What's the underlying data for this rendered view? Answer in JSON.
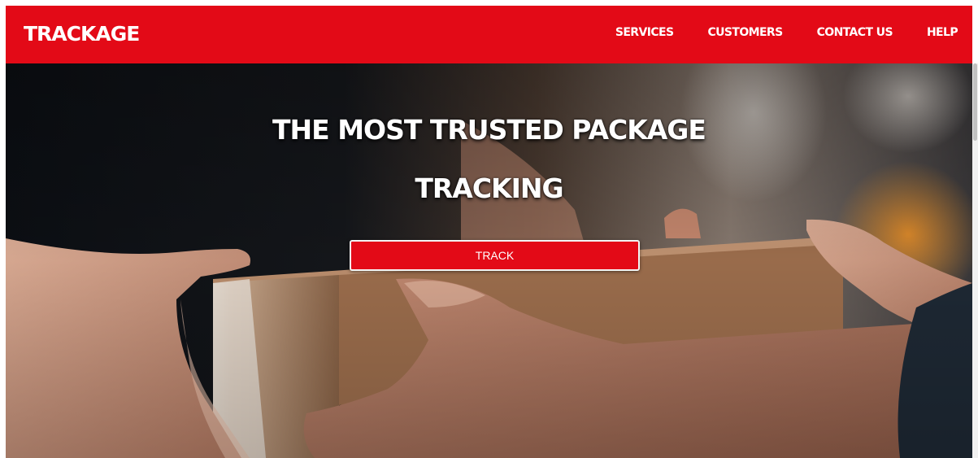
{
  "brand": {
    "name": "TRACKAGE"
  },
  "nav": {
    "items": [
      {
        "label": "SERVICES"
      },
      {
        "label": "CUSTOMERS"
      },
      {
        "label": "CONTACT US"
      },
      {
        "label": "HELP"
      }
    ]
  },
  "hero": {
    "headline_line1": "THE MOST TRUSTED PACKAGE",
    "headline_line2": "TRACKING",
    "cta_label": "TRACK",
    "image_subject": "hands-handing-over-cardboard-box-photo"
  },
  "colors": {
    "brand_red": "#e30a17",
    "text_white": "#ffffff"
  }
}
